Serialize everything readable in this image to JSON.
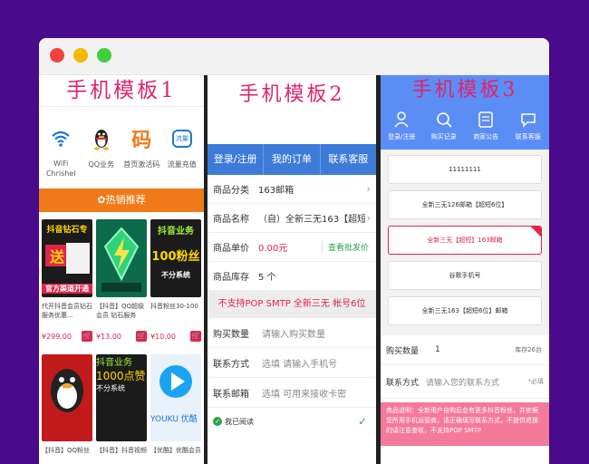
{
  "templates": {
    "t1": "手机模板1",
    "t2": "手机模板2",
    "t3": "手机模板3"
  },
  "panel1": {
    "icons": [
      {
        "label": "WiFi",
        "sub": "Chrishel",
        "icon": "wifi-icon"
      },
      {
        "label": "QQ业务",
        "icon": "qq-penguin-icon"
      },
      {
        "label": "首页激活码",
        "glyph": "码",
        "icon": "code-icon"
      },
      {
        "label": "流量充值",
        "glyph": "流量",
        "icon": "data-icon"
      }
    ],
    "section": "热销推荐",
    "products": [
      {
        "top": "抖音钻石专",
        "mid": "送",
        "bot": "官方渠道开通",
        "name": "代开抖音会员钻石服务优惠...",
        "price": "¥299.00"
      },
      {
        "top": "",
        "mid": "",
        "bot": "",
        "name": "【抖音】QQ超级会员 钻石服务",
        "price": "¥13.00"
      },
      {
        "top": "抖音业务",
        "mid": "100粉丝",
        "bot": "不分系统",
        "name": "抖音粉丝30-100",
        "price": "¥10.00"
      }
    ],
    "products2": [
      {
        "name": "【抖音】QQ粉丝"
      },
      {
        "top": "抖音业务",
        "mid": "1000点赞",
        "bot": "不分系统",
        "name": "【抖音】抖音视频"
      },
      {
        "mid": "YOUKU 优酷",
        "name": "【优酷】优酷会员"
      }
    ]
  },
  "panel2": {
    "tabs": [
      "登录/注册",
      "我的订单",
      "联系客服"
    ],
    "rows": [
      {
        "k": "商品分类",
        "v": "163邮箱"
      },
      {
        "k": "商品名称",
        "v": "（自）全新三无163【超短6位】邮件"
      },
      {
        "k": "商品单价",
        "v": "0.00元",
        "link": "查看批发价"
      },
      {
        "k": "商品库存",
        "v": "5 个"
      }
    ],
    "warning": "不支持POP SMTP 全新三无 帐号6位",
    "inputs": [
      {
        "k": "购买数量",
        "ph": "请输入购买数量"
      },
      {
        "k": "联系方式",
        "ph": "选填 请输入手机号"
      },
      {
        "k": "联系邮箱",
        "ph": "选填 可用来接收卡密"
      }
    ],
    "agree": "我已阅读"
  },
  "panel3": {
    "nav": [
      "登录/注册",
      "购买记录",
      "商家公告",
      "联系客服"
    ],
    "options": [
      "11111111",
      "全新三无126邮箱【超短6位】",
      "全新三无【超短】163邮箱",
      "谷歌手机号",
      "全新三无163【超短6位】邮箱"
    ],
    "qty_label": "购买数量",
    "qty_value": "1",
    "stock": "库存26台",
    "contact_label": "联系方式",
    "contact_ph": "请输入您的联系方式",
    "required": "*必填",
    "note": "商品说明：全新用户自购后会有更多抖音粉丝，并依据您所用手机运营商，请正确填写联系方式，不提供退换的请注意查收，不支持POP SMTP"
  },
  "colors": {
    "background": "#4a0a8c",
    "title": "#e0246e",
    "blue": "#3d7bd9",
    "orange": "#f07a1a",
    "price": "#e0244a"
  }
}
